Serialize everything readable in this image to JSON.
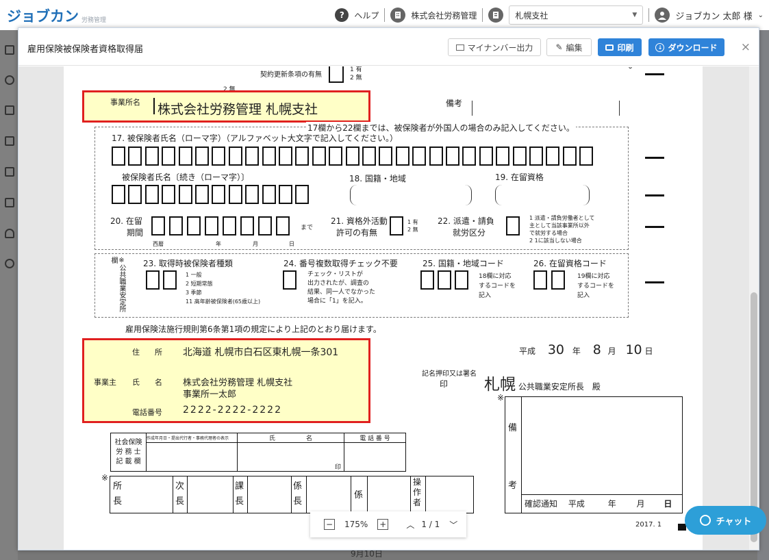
{
  "app": {
    "logo_text": "ジョブカン",
    "logo_sub": "労務管理",
    "help": "ヘルプ",
    "company": "株式会社労務管理",
    "branch_select": "札幌支社",
    "user": "ジョブカン 太郎 様"
  },
  "modal": {
    "title": "雇用保険被保険者資格取得届",
    "btn_mynumber": "マイナンバー出力",
    "btn_edit": "編集",
    "btn_print": "印刷",
    "btn_download": "ダウンロード",
    "close": "×"
  },
  "form": {
    "contract_renewal": "契約更新条項の有無",
    "opt_yes": "有",
    "opt_no": "無",
    "num1": "1",
    "num2": "2",
    "two_none": "2 無",
    "office_name_label": "事業所名",
    "office_name_value": "株式会社労務管理 札幌支社",
    "remarks_label": "備考",
    "foreign_note": "17欄から22欄までは、被保険者が外国人の場合のみ記入してください。",
    "f17": "17. 被保険者氏名（ローマ字）（アルファベット大文字で記入してください。）",
    "f17b": "被保険者氏名〔続き（ローマ字）〕",
    "f18": "18. 国籍・地域",
    "f19": "19. 在留資格",
    "f20a": "20. 在留",
    "f20b": "期間",
    "f20_made": "まで",
    "f20_era": "西暦",
    "f20_y": "年",
    "f20_m": "月",
    "f20_d": "日",
    "f21a": "21. 資格外活動",
    "f21b": "許可の有無",
    "f21_o1": "1 有",
    "f21_o2": "2 無",
    "f22a": "22. 派遣・請負",
    "f22b": "就労区分",
    "f22_o1": "1 派遣・請負労働者として",
    "f22_o1b": "主として当該事業所以外",
    "f22_o1c": "で就労する場合",
    "f22_o2": "2 1に該当しない場合",
    "side_label": "※公共職業安定所欄",
    "f23": "23. 取得時被保険者種類",
    "f23_o1": "1 一般",
    "f23_o2": "2 短期常態",
    "f23_o3": "3 季節",
    "f23_o4": "11 高年齢被保険者(65歳以上)",
    "f24": "24. 番号複数取得チェック不要",
    "f24_n1": "チェック・リストが",
    "f24_n2": "出力されたが、調査の",
    "f24_n3": "結果、同一人でなかった",
    "f24_n4": "場合に「1」を記入。",
    "f25": "25. 国籍・地域コード",
    "f25_n1": "18欄に対応",
    "f25_n2": "するコードを",
    "f25_n3": "記入",
    "f26": "26. 在留資格コード",
    "f26_n1": "19欄に対応",
    "f26_n2": "するコードを",
    "f26_n3": "記入",
    "law_note": "雇用保険法施行規則第6条第1項の規定により上記のとおり届けます。",
    "date_era": "平成",
    "date_year": "30",
    "date_year_unit": "年",
    "date_month": "8",
    "date_month_unit": "月",
    "date_day": "10",
    "date_day_unit": "日",
    "addr_label": "住　　所",
    "addr_value": "北海道 札幌市白石区東札幌一条301",
    "employer_label": "事業主",
    "name_label": "氏　　名",
    "name_value1": "株式会社労務管理 札幌支社",
    "name_value2": "事業所一太郎",
    "tel_label": "電話番号",
    "tel_value": "2222-2222-2222",
    "sign_note": "記名押印又は署名",
    "seal": "印",
    "office_city": "札幌",
    "office_suffix": "公共職業安定所長　殿",
    "asterisk": "※",
    "remark_col1": "備",
    "remark_col2": "考",
    "confirm_label": "確認通知",
    "confirm_era": "平成",
    "confirm_y": "年",
    "confirm_m": "月",
    "confirm_d": "日",
    "sr_label1": "社会保険",
    "sr_label2": "労 務 士",
    "sr_label3": "記 載 欄",
    "sr_col1": "作成年月日・提出代行者・事務代理者の表示",
    "sr_col2": "氏　　　　　名",
    "sr_col3": "電 話 番 号",
    "sr_seal": "印",
    "st1": "所長",
    "st2": "次長",
    "st3": "課長",
    "st4": "係長",
    "st5": "係",
    "st6": "操作者",
    "footer_year": "2017. 1"
  },
  "viewer": {
    "zoom": "175%",
    "page": "1 / 1"
  },
  "chat": {
    "label": "チャット"
  },
  "background": {
    "date_partial": "9月10日"
  },
  "colors": {
    "accent": "#2f83d9",
    "highlight_border": "#e0201f",
    "highlight_fill": "#ffffc7"
  }
}
